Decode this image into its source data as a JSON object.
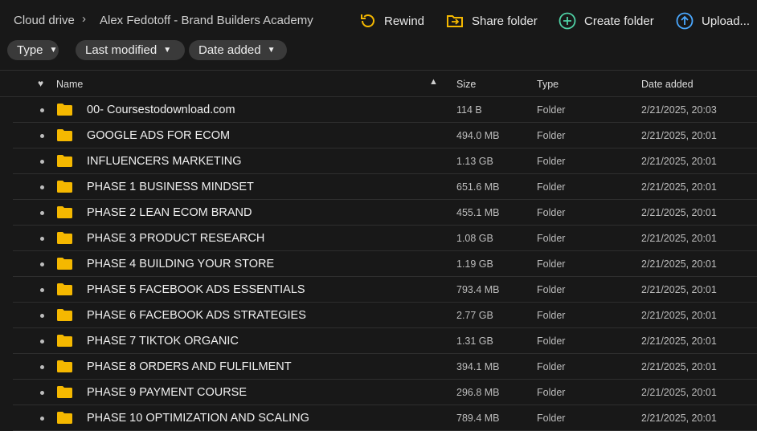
{
  "breadcrumb": {
    "root": "Cloud drive",
    "separator": "›",
    "current": "Alex Fedotoff - Brand Builders Academy"
  },
  "actions": {
    "rewind": "Rewind",
    "share": "Share folder",
    "create": "Create folder",
    "upload": "Upload..."
  },
  "filters": {
    "type": "Type",
    "modified": "Last modified",
    "date_added": "Date added"
  },
  "table": {
    "headers": {
      "name": "Name",
      "size": "Size",
      "type": "Type",
      "date": "Date added"
    },
    "rows": [
      {
        "name": "00- Coursestodownload.com",
        "size": "114 B",
        "type": "Folder",
        "date": "2/21/2025, 20:03"
      },
      {
        "name": "GOOGLE ADS FOR ECOM",
        "size": "494.0 MB",
        "type": "Folder",
        "date": "2/21/2025, 20:01"
      },
      {
        "name": "INFLUENCERS MARKETING",
        "size": "1.13 GB",
        "type": "Folder",
        "date": "2/21/2025, 20:01"
      },
      {
        "name": "PHASE 1 BUSINESS MINDSET",
        "size": "651.6 MB",
        "type": "Folder",
        "date": "2/21/2025, 20:01"
      },
      {
        "name": "PHASE 2 LEAN ECOM BRAND",
        "size": "455.1 MB",
        "type": "Folder",
        "date": "2/21/2025, 20:01"
      },
      {
        "name": "PHASE 3 PRODUCT RESEARCH",
        "size": "1.08 GB",
        "type": "Folder",
        "date": "2/21/2025, 20:01"
      },
      {
        "name": "PHASE 4 BUILDING YOUR STORE",
        "size": "1.19 GB",
        "type": "Folder",
        "date": "2/21/2025, 20:01"
      },
      {
        "name": "PHASE 5 FACEBOOK ADS ESSENTIALS",
        "size": "793.4 MB",
        "type": "Folder",
        "date": "2/21/2025, 20:01"
      },
      {
        "name": "PHASE 6 FACEBOOK ADS STRATEGIES",
        "size": "2.77 GB",
        "type": "Folder",
        "date": "2/21/2025, 20:01"
      },
      {
        "name": "PHASE 7 TIKTOK ORGANIC",
        "size": "1.31 GB",
        "type": "Folder",
        "date": "2/21/2025, 20:01"
      },
      {
        "name": "PHASE 8 ORDERS AND FULFILMENT",
        "size": "394.1 MB",
        "type": "Folder",
        "date": "2/21/2025, 20:01"
      },
      {
        "name": "PHASE 9 PAYMENT COURSE",
        "size": "296.8 MB",
        "type": "Folder",
        "date": "2/21/2025, 20:01"
      },
      {
        "name": "PHASE 10 OPTIMIZATION AND SCALING",
        "size": "789.4 MB",
        "type": "Folder",
        "date": "2/21/2025, 20:01"
      }
    ]
  },
  "colors": {
    "background": "#181818",
    "folder": "#f5b800",
    "rewind_accent": "#f5b800",
    "share_accent": "#f5b800",
    "create_accent": "#4fd1a5",
    "upload_accent": "#4aa8ff"
  },
  "icons": {
    "rewind": "rewind-icon",
    "share": "share-folder-icon",
    "create": "plus-circle-icon",
    "upload": "upload-icon",
    "folder": "folder-icon",
    "favorite": "heart-icon",
    "sort": "sort-ascending-icon"
  }
}
